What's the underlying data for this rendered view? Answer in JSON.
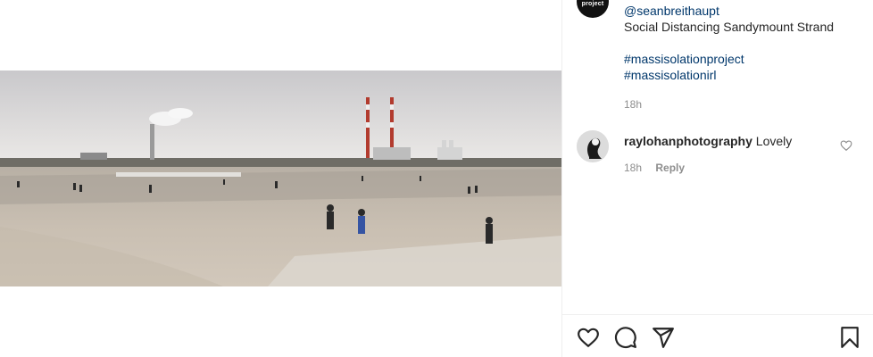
{
  "post": {
    "media_alt": "",
    "caption": {
      "mention": "@seanbreithaupt",
      "text": "Social Distancing Sandymount Strand",
      "hashtags": [
        "#massisolationproject",
        "#massisolationirl"
      ],
      "time": "18h"
    },
    "owner_avatar_text": "project"
  },
  "comments": [
    {
      "username": "raylohanphotography",
      "text": "Lovely",
      "time": "18h",
      "reply_label": "Reply"
    }
  ],
  "actions": {
    "like_icon": "heart-icon",
    "comment_icon": "comment-icon",
    "share_icon": "paper-plane-icon",
    "save_icon": "bookmark-icon"
  },
  "colors": {
    "link": "#00376b",
    "meta": "#8e8e8e",
    "text": "#262626",
    "border": "#efefef"
  }
}
